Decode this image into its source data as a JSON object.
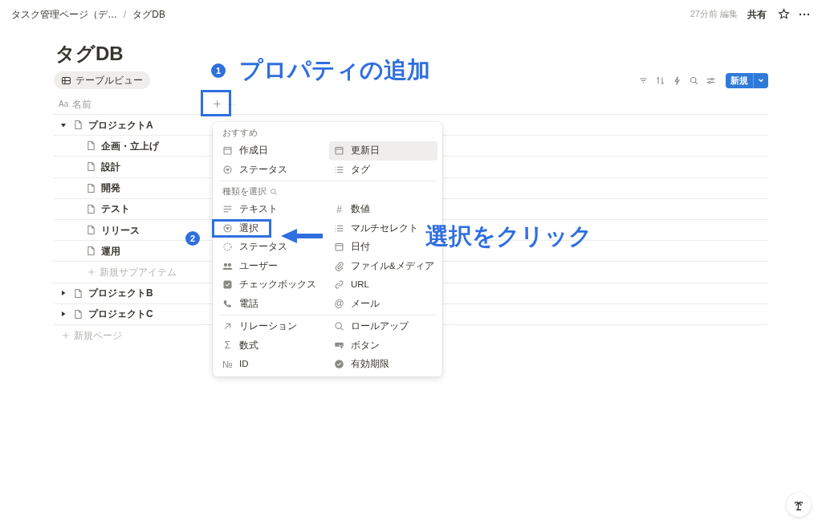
{
  "topbar": {
    "breadcrumbs": [
      "タスク管理ページ（デ…",
      "タグDB"
    ],
    "separator": "/",
    "edited": "27分前 編集",
    "share": "共有"
  },
  "page": {
    "title": "タグDB",
    "view_tab": "テーブルビュー"
  },
  "toolbar": {
    "new_button": "新規"
  },
  "table": {
    "columns": [
      {
        "label": "名前",
        "type_glyph": "Aa"
      }
    ],
    "rows": [
      {
        "title": "プロジェクトA",
        "expanded": true,
        "children": [
          {
            "title": "企画・立上げ"
          },
          {
            "title": "設計"
          },
          {
            "title": "開発"
          },
          {
            "title": "テスト"
          },
          {
            "title": "リリース"
          },
          {
            "title": "運用"
          }
        ],
        "add_sub": "新規サブアイテム"
      },
      {
        "title": "プロジェクトB",
        "expanded": false
      },
      {
        "title": "プロジェクトC",
        "expanded": false
      }
    ],
    "new_page": "新規ページ"
  },
  "menu": {
    "sections": [
      {
        "label": "おすすめ",
        "search": false,
        "items": [
          {
            "label": "作成日",
            "kind": "calendar",
            "selected": false
          },
          {
            "label": "更新日",
            "kind": "calendar",
            "selected": true
          },
          {
            "label": "ステータス",
            "kind": "select",
            "selected": false
          },
          {
            "label": "タグ",
            "kind": "list",
            "selected": false
          }
        ]
      },
      {
        "label": "種類を選択",
        "search": true,
        "items": [
          {
            "label": "テキスト",
            "kind": "lines",
            "selected": false
          },
          {
            "label": "数値",
            "kind": "glyph",
            "glyph": "#",
            "selected": false
          },
          {
            "label": "選択",
            "kind": "select",
            "selected": false
          },
          {
            "label": "マルチセレクト",
            "kind": "list",
            "selected": false
          },
          {
            "label": "ステータス",
            "kind": "dashed",
            "selected": false
          },
          {
            "label": "日付",
            "kind": "calendar",
            "selected": false
          },
          {
            "label": "ユーザー",
            "kind": "people",
            "selected": false
          },
          {
            "label": "ファイル&メディア",
            "kind": "clip",
            "selected": false
          },
          {
            "label": "チェックボックス",
            "kind": "checkbox",
            "selected": false
          },
          {
            "label": "URL",
            "kind": "link",
            "selected": false
          },
          {
            "label": "電話",
            "kind": "phone",
            "selected": false
          },
          {
            "label": "メール",
            "kind": "glyph",
            "glyph": "@",
            "selected": false
          }
        ]
      },
      {
        "items": [
          {
            "label": "リレーション",
            "kind": "arrow",
            "selected": false
          },
          {
            "label": "ロールアップ",
            "kind": "search",
            "selected": false
          },
          {
            "label": "数式",
            "kind": "glyph",
            "glyph": "Σ",
            "selected": false
          },
          {
            "label": "ボタン",
            "kind": "cursor",
            "selected": false
          },
          {
            "label": "ID",
            "kind": "glyph",
            "glyph": "№",
            "selected": false
          },
          {
            "label": "有効期限",
            "kind": "badge",
            "selected": false
          }
        ]
      }
    ]
  },
  "annotations": [
    {
      "number": "1",
      "text": "プロパティの追加"
    },
    {
      "number": "2",
      "text": "選択をクリック"
    }
  ]
}
